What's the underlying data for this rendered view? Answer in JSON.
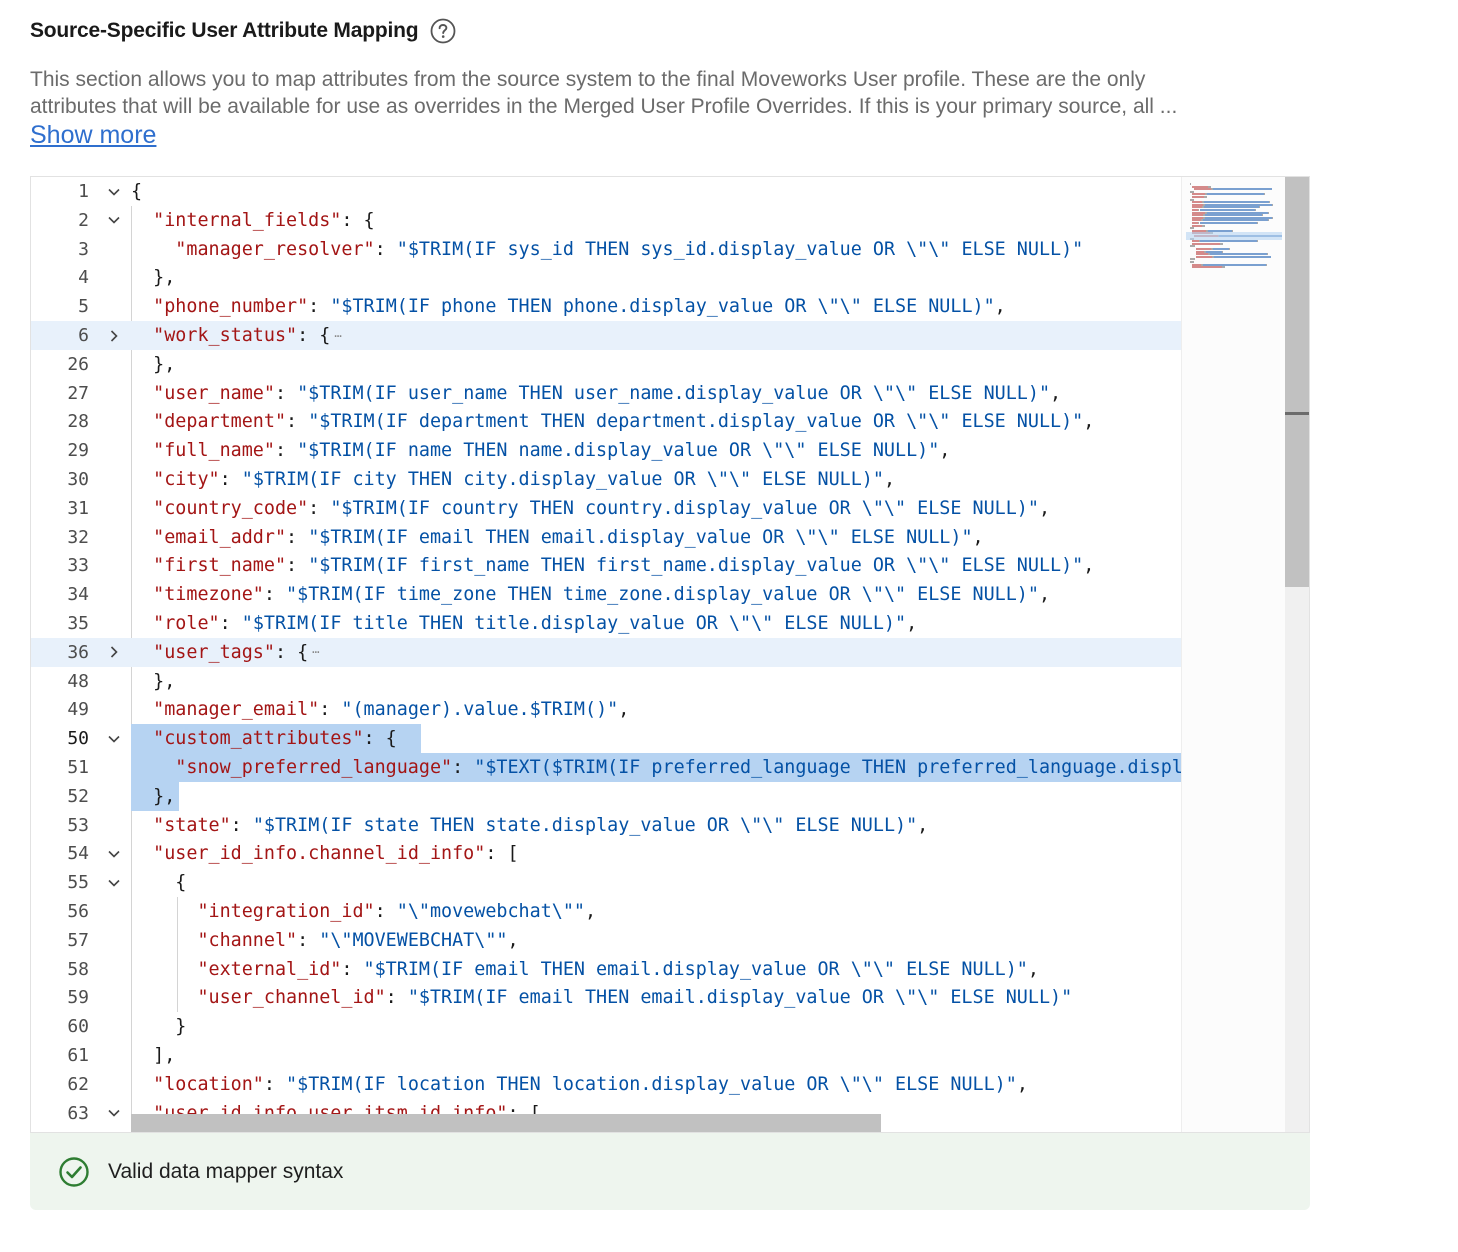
{
  "section": {
    "title": "Source-Specific User Attribute Mapping",
    "help_icon": "question-circle-icon",
    "description_line1": "This section allows you to map attributes from the source system to the final Moveworks User profile. These are the only",
    "description_line2": "attributes that will be available for use as overrides in the Merged User Profile Overrides. If this is your primary source, all ...",
    "show_more": "Show more"
  },
  "editor": {
    "lines": [
      {
        "num": "1",
        "fold": "open",
        "parts": [
          [
            "p",
            "{"
          ]
        ]
      },
      {
        "num": "2",
        "fold": "open",
        "parts": [
          [
            "p",
            "  "
          ],
          [
            "k",
            "\"internal_fields\""
          ],
          [
            "p",
            ": {"
          ]
        ]
      },
      {
        "num": "3",
        "fold": "",
        "parts": [
          [
            "p",
            "    "
          ],
          [
            "k",
            "\"manager_resolver\""
          ],
          [
            "p",
            ": "
          ],
          [
            "s",
            "\"$TRIM(IF sys_id THEN sys_id.display_value OR \\\"\\\" ELSE NULL)\""
          ]
        ]
      },
      {
        "num": "4",
        "fold": "",
        "parts": [
          [
            "p",
            "  },"
          ]
        ]
      },
      {
        "num": "5",
        "fold": "",
        "parts": [
          [
            "p",
            "  "
          ],
          [
            "k",
            "\"phone_number\""
          ],
          [
            "p",
            ": "
          ],
          [
            "s",
            "\"$TRIM(IF phone THEN phone.display_value OR \\\"\\\" ELSE NULL)\""
          ],
          [
            "p",
            ","
          ]
        ]
      },
      {
        "num": "6",
        "fold": "closed",
        "hl": true,
        "ellipsis": true,
        "parts": [
          [
            "p",
            "  "
          ],
          [
            "k",
            "\"work_status\""
          ],
          [
            "p",
            ": {"
          ]
        ]
      },
      {
        "num": "26",
        "fold": "",
        "parts": [
          [
            "p",
            "  },"
          ]
        ]
      },
      {
        "num": "27",
        "fold": "",
        "parts": [
          [
            "p",
            "  "
          ],
          [
            "k",
            "\"user_name\""
          ],
          [
            "p",
            ": "
          ],
          [
            "s",
            "\"$TRIM(IF user_name THEN user_name.display_value OR \\\"\\\" ELSE NULL)\""
          ],
          [
            "p",
            ","
          ]
        ]
      },
      {
        "num": "28",
        "fold": "",
        "parts": [
          [
            "p",
            "  "
          ],
          [
            "k",
            "\"department\""
          ],
          [
            "p",
            ": "
          ],
          [
            "s",
            "\"$TRIM(IF department THEN department.display_value OR \\\"\\\" ELSE NULL)\""
          ],
          [
            "p",
            ","
          ]
        ]
      },
      {
        "num": "29",
        "fold": "",
        "parts": [
          [
            "p",
            "  "
          ],
          [
            "k",
            "\"full_name\""
          ],
          [
            "p",
            ": "
          ],
          [
            "s",
            "\"$TRIM(IF name THEN name.display_value OR \\\"\\\" ELSE NULL)\""
          ],
          [
            "p",
            ","
          ]
        ]
      },
      {
        "num": "30",
        "fold": "",
        "parts": [
          [
            "p",
            "  "
          ],
          [
            "k",
            "\"city\""
          ],
          [
            "p",
            ": "
          ],
          [
            "s",
            "\"$TRIM(IF city THEN city.display_value OR \\\"\\\" ELSE NULL)\""
          ],
          [
            "p",
            ","
          ]
        ]
      },
      {
        "num": "31",
        "fold": "",
        "parts": [
          [
            "p",
            "  "
          ],
          [
            "k",
            "\"country_code\""
          ],
          [
            "p",
            ": "
          ],
          [
            "s",
            "\"$TRIM(IF country THEN country.display_value OR \\\"\\\" ELSE NULL)\""
          ],
          [
            "p",
            ","
          ]
        ]
      },
      {
        "num": "32",
        "fold": "",
        "parts": [
          [
            "p",
            "  "
          ],
          [
            "k",
            "\"email_addr\""
          ],
          [
            "p",
            ": "
          ],
          [
            "s",
            "\"$TRIM(IF email THEN email.display_value OR \\\"\\\" ELSE NULL)\""
          ],
          [
            "p",
            ","
          ]
        ]
      },
      {
        "num": "33",
        "fold": "",
        "parts": [
          [
            "p",
            "  "
          ],
          [
            "k",
            "\"first_name\""
          ],
          [
            "p",
            ": "
          ],
          [
            "s",
            "\"$TRIM(IF first_name THEN first_name.display_value OR \\\"\\\" ELSE NULL)\""
          ],
          [
            "p",
            ","
          ]
        ]
      },
      {
        "num": "34",
        "fold": "",
        "parts": [
          [
            "p",
            "  "
          ],
          [
            "k",
            "\"timezone\""
          ],
          [
            "p",
            ": "
          ],
          [
            "s",
            "\"$TRIM(IF time_zone THEN time_zone.display_value OR \\\"\\\" ELSE NULL)\""
          ],
          [
            "p",
            ","
          ]
        ]
      },
      {
        "num": "35",
        "fold": "",
        "parts": [
          [
            "p",
            "  "
          ],
          [
            "k",
            "\"role\""
          ],
          [
            "p",
            ": "
          ],
          [
            "s",
            "\"$TRIM(IF title THEN title.display_value OR \\\"\\\" ELSE NULL)\""
          ],
          [
            "p",
            ","
          ]
        ]
      },
      {
        "num": "36",
        "fold": "closed",
        "hl": true,
        "ellipsis": true,
        "parts": [
          [
            "p",
            "  "
          ],
          [
            "k",
            "\"user_tags\""
          ],
          [
            "p",
            ": {"
          ]
        ]
      },
      {
        "num": "48",
        "fold": "",
        "parts": [
          [
            "p",
            "  },"
          ]
        ]
      },
      {
        "num": "49",
        "fold": "",
        "parts": [
          [
            "p",
            "  "
          ],
          [
            "k",
            "\"manager_email\""
          ],
          [
            "p",
            ": "
          ],
          [
            "s",
            "\"(manager).value.$TRIM()\""
          ],
          [
            "p",
            ","
          ]
        ]
      },
      {
        "num": "50",
        "fold": "open",
        "active": true,
        "sel": 1,
        "parts": [
          [
            "p",
            "  "
          ],
          [
            "k",
            "\"custom_attributes\""
          ],
          [
            "p",
            ": {"
          ]
        ]
      },
      {
        "num": "51",
        "fold": "",
        "sel": 2,
        "parts": [
          [
            "p",
            "    "
          ],
          [
            "k",
            "\"snow_preferred_language\""
          ],
          [
            "p",
            ": "
          ],
          [
            "s",
            "\"$TEXT($TRIM(IF preferred_language THEN preferred_language.display_value OR \\\"\\\" ELSE NULL))\""
          ]
        ]
      },
      {
        "num": "52",
        "fold": "",
        "sel": 3,
        "parts": [
          [
            "p",
            "  },"
          ]
        ]
      },
      {
        "num": "53",
        "fold": "",
        "parts": [
          [
            "p",
            "  "
          ],
          [
            "k",
            "\"state\""
          ],
          [
            "p",
            ": "
          ],
          [
            "s",
            "\"$TRIM(IF state THEN state.display_value OR \\\"\\\" ELSE NULL)\""
          ],
          [
            "p",
            ","
          ]
        ]
      },
      {
        "num": "54",
        "fold": "open",
        "parts": [
          [
            "p",
            "  "
          ],
          [
            "k",
            "\"user_id_info.channel_id_info\""
          ],
          [
            "p",
            ": ["
          ]
        ]
      },
      {
        "num": "55",
        "fold": "open",
        "parts": [
          [
            "p",
            "    {"
          ]
        ]
      },
      {
        "num": "56",
        "fold": "",
        "parts": [
          [
            "p",
            "      "
          ],
          [
            "k",
            "\"integration_id\""
          ],
          [
            "p",
            ": "
          ],
          [
            "s",
            "\"\\\"movewebchat\\\"\""
          ],
          [
            "p",
            ","
          ]
        ]
      },
      {
        "num": "57",
        "fold": "",
        "parts": [
          [
            "p",
            "      "
          ],
          [
            "k",
            "\"channel\""
          ],
          [
            "p",
            ": "
          ],
          [
            "s",
            "\"\\\"MOVEWEBCHAT\\\"\""
          ],
          [
            "p",
            ","
          ]
        ]
      },
      {
        "num": "58",
        "fold": "",
        "parts": [
          [
            "p",
            "      "
          ],
          [
            "k",
            "\"external_id\""
          ],
          [
            "p",
            ": "
          ],
          [
            "s",
            "\"$TRIM(IF email THEN email.display_value OR \\\"\\\" ELSE NULL)\""
          ],
          [
            "p",
            ","
          ]
        ]
      },
      {
        "num": "59",
        "fold": "",
        "parts": [
          [
            "p",
            "      "
          ],
          [
            "k",
            "\"user_channel_id\""
          ],
          [
            "p",
            ": "
          ],
          [
            "s",
            "\"$TRIM(IF email THEN email.display_value OR \\\"\\\" ELSE NULL)\""
          ]
        ]
      },
      {
        "num": "60",
        "fold": "",
        "parts": [
          [
            "p",
            "    }"
          ]
        ]
      },
      {
        "num": "61",
        "fold": "",
        "parts": [
          [
            "p",
            "  ],"
          ]
        ]
      },
      {
        "num": "62",
        "fold": "",
        "parts": [
          [
            "p",
            "  "
          ],
          [
            "k",
            "\"location\""
          ],
          [
            "p",
            ": "
          ],
          [
            "s",
            "\"$TRIM(IF location THEN location.display_value OR \\\"\\\" ELSE NULL)\""
          ],
          [
            "p",
            ","
          ]
        ]
      },
      {
        "num": "63",
        "fold": "open",
        "parts": [
          [
            "p",
            "  "
          ],
          [
            "k",
            "\"user_id_info.user_itsm_id_info\""
          ],
          [
            "p",
            ": ["
          ]
        ]
      }
    ]
  },
  "status": {
    "icon": "check-circle-icon",
    "text": "Valid data mapper syntax",
    "color": "#2e7d32"
  },
  "colors": {
    "key": "#a31515",
    "string": "#0451a5",
    "link": "#2f6fce",
    "selection": "#b6d3f2",
    "folded_highlight": "#e8f1fb"
  }
}
